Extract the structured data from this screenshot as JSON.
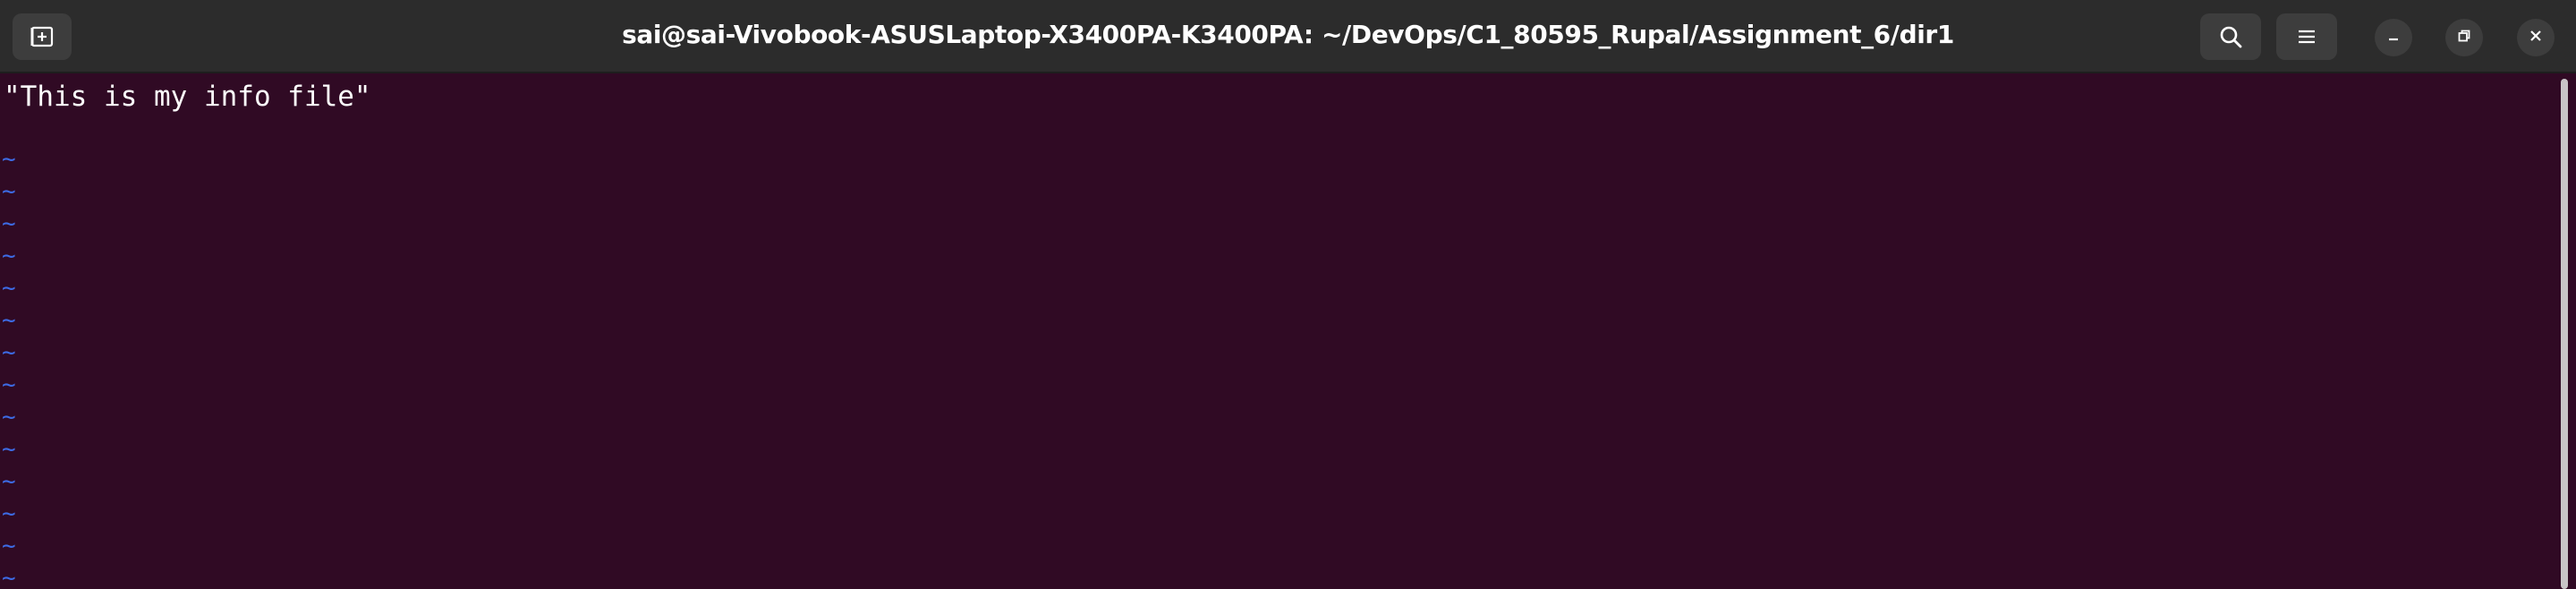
{
  "window": {
    "title": "sai@sai-Vivobook-ASUSLaptop-X3400PA-K3400PA: ~/DevOps/C1_80595_Rupal/Assignment_6/dir1"
  },
  "header": {
    "new_tab_icon": "new-tab-icon",
    "search_icon": "search-icon",
    "menu_icon": "hamburger-menu-icon",
    "minimize_icon": "minimize-icon",
    "maximize_icon": "restore-icon",
    "close_icon": "close-icon"
  },
  "editor": {
    "lines": [
      "\"This is my info file\""
    ],
    "empty_line_marker": "~",
    "empty_lines_count": 14
  },
  "colors": {
    "background": "#300a24",
    "headerbar": "#2c2c2c",
    "text": "#ffffff",
    "tilde": "#3d6be5"
  }
}
